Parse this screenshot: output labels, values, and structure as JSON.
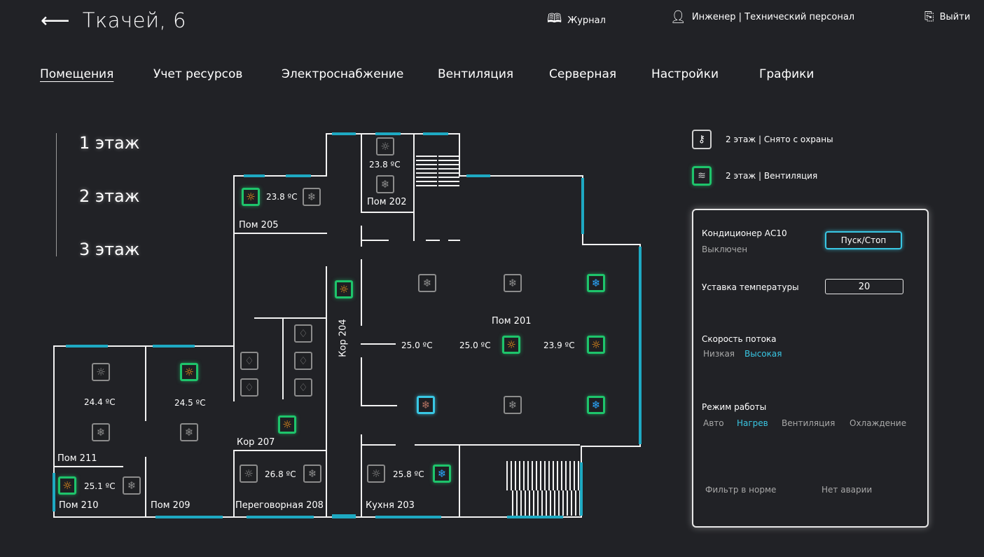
{
  "header": {
    "back_arrow": "⟵",
    "title": "Ткачей, 6",
    "journal": "Журнал",
    "user": "Инженер | Технический персонал",
    "exit": "Выйти"
  },
  "nav": [
    "Помещения",
    "Учет ресурсов",
    "Электроснабжение",
    "Вентиляция",
    "Серверная",
    "Настройки",
    "Графики"
  ],
  "floors": [
    "1 этаж",
    "2 этаж",
    "3 этаж"
  ],
  "rooms": {
    "r205": "Пом 205",
    "r202": "Пом 202",
    "r204": "Кор 204",
    "r201": "Пом 201",
    "r207": "Кор 207",
    "r211": "Пом 211",
    "r210": "Пом 210",
    "r209": "Пом 209",
    "r208": "Переговорная 208",
    "r203": "Кухня 203"
  },
  "temps": {
    "t205": "23.8 ºC",
    "t202": "23.8 ºC",
    "t201a": "25.0 ºC",
    "t201b": "25.0 ºC",
    "t201c": "23.9 ºC",
    "t211": "24.4 ºC",
    "t209": "24.5 ºC",
    "t210": "25.1 ºC",
    "t208": "26.8 ºC",
    "t203": "25.8 ºC"
  },
  "status": {
    "security": "2 этаж | Снято с охраны",
    "ventilation": "2 этаж | Вентиляция"
  },
  "panel": {
    "ac_title": "Кондиционер АС10",
    "ac_state": "Выключен",
    "start_stop": "Пуск/Стоп",
    "setpoint_label": "Уставка температуры",
    "setpoint_value": "20",
    "flow_label": "Скорость потока",
    "flow_low": "Низкая",
    "flow_high": "Высокая",
    "mode_label": "Режим работы",
    "mode_auto": "Авто",
    "mode_heat": "Нагрев",
    "mode_vent": "Вентиляция",
    "mode_cool": "Охлаждение",
    "filter": "Фильтр в норме",
    "alarm": "Нет аварии"
  },
  "colors": {
    "accent_cyan": "#39c7e4",
    "active_green": "#1ec46b",
    "bulb_on": "#ff9a1a",
    "background": "#212226"
  },
  "icons": {
    "bulb": "light-bulb-icon",
    "snowflake": "snowflake-icon",
    "drop": "water-drop-icon",
    "key": "key-icon",
    "fan": "ventilation-icon",
    "book": "book-icon",
    "user": "user-icon",
    "exit": "exit-icon"
  }
}
